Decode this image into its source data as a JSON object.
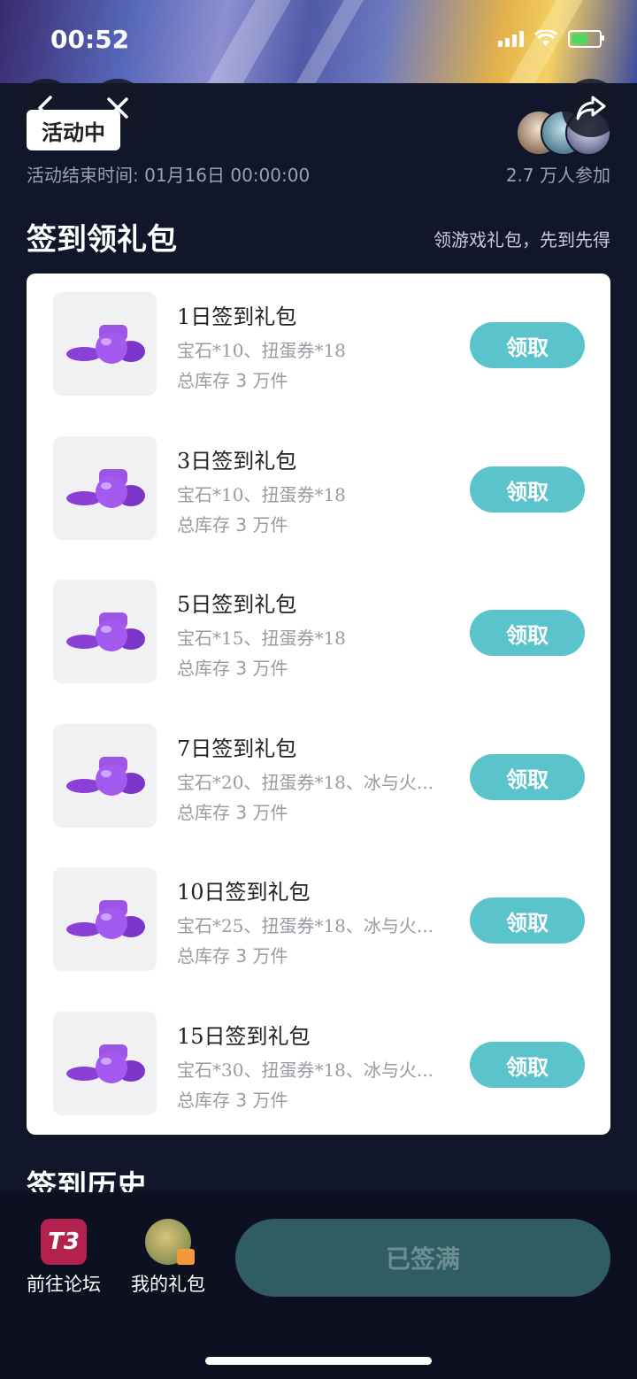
{
  "status_bar": {
    "time": "00:52"
  },
  "header": {
    "badge": "活动中",
    "end_time": "活动结束时间: 01月16日 00:00:00",
    "participants": "2.7 万人参加"
  },
  "section": {
    "title": "签到领礼包",
    "subtitle": "领游戏礼包，先到先得"
  },
  "gifts": [
    {
      "title": "1日签到礼包",
      "desc": "宝石*10、扭蛋券*18",
      "stock": "总库存 3 万件",
      "button": "领取"
    },
    {
      "title": "3日签到礼包",
      "desc": "宝石*10、扭蛋券*18",
      "stock": "总库存 3 万件",
      "button": "领取"
    },
    {
      "title": "5日签到礼包",
      "desc": "宝石*15、扭蛋券*18",
      "stock": "总库存 3 万件",
      "button": "领取"
    },
    {
      "title": "7日签到礼包",
      "desc": "宝石*20、扭蛋券*18、冰与火...",
      "stock": "总库存 3 万件",
      "button": "领取"
    },
    {
      "title": "10日签到礼包",
      "desc": "宝石*25、扭蛋券*18、冰与火...",
      "stock": "总库存 3 万件",
      "button": "领取"
    },
    {
      "title": "15日签到礼包",
      "desc": "宝石*30、扭蛋券*18、冰与火...",
      "stock": "总库存 3 万件",
      "button": "领取"
    }
  ],
  "history": {
    "title": "签到历史"
  },
  "bottom": {
    "forum_icon_text": "T3",
    "forum_label": "前往论坛",
    "gifts_label": "我的礼包",
    "signed_button": "已签满"
  },
  "colors": {
    "accent": "#5bc3cb",
    "background": "#11162b"
  }
}
